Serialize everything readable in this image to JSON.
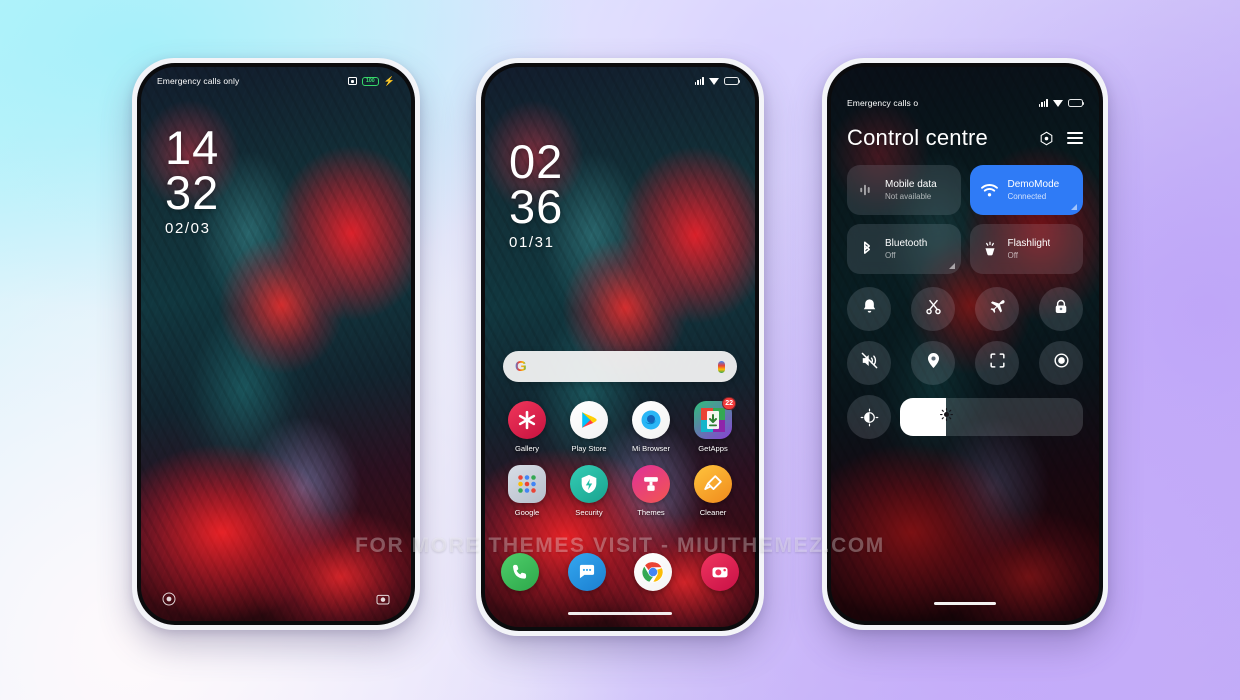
{
  "background": {
    "gradient_from": "#bdf4fb",
    "gradient_mid": "#eef0fd",
    "gradient_to": "#c3aff5"
  },
  "watermark": {
    "text": "FOR MORE THEMES VISIT - MIUITHEMEZ.COM"
  },
  "phone_lockscreen": {
    "status_bar": {
      "carrier": "Emergency calls only",
      "camera_icon": "camera-icon",
      "battery_level": "100",
      "charging_icon": "lightning-bolt-icon"
    },
    "clock": {
      "hours": "14",
      "minutes": "32",
      "date": "02/03"
    },
    "shortcuts": {
      "left": "flashlight-icon",
      "right": "camera-icon"
    }
  },
  "phone_homescreen": {
    "status_bar": {
      "signal_icon": "signal-bars-icon",
      "wifi_icon": "wifi-icon",
      "battery_icon": "battery-icon"
    },
    "clock": {
      "hours": "02",
      "minutes": "36",
      "date": "01/31"
    },
    "search": {
      "google_icon": "google-g-icon",
      "mic_icon": "microphone-icon",
      "placeholder": ""
    },
    "apps_row1": [
      {
        "label": "Gallery",
        "icon": "gallery-icon",
        "color1": "#f0365b",
        "color2": "#c7123f",
        "glyph": "✳",
        "badge": ""
      },
      {
        "label": "Play Store",
        "icon": "play-store-icon",
        "color1": "#ffffff",
        "color2": "#f2f2f2",
        "glyph": "▶",
        "badge": ""
      },
      {
        "label": "Mi Browser",
        "icon": "mi-browser-icon",
        "color1": "#ffffff",
        "color2": "#f2f2f2",
        "glyph": "◕",
        "badge": ""
      },
      {
        "label": "GetApps",
        "icon": "getapps-icon",
        "color1": "#2fc07a",
        "color2": "#8a3fd6",
        "glyph": "⬇",
        "badge": "22"
      }
    ],
    "apps_row2": [
      {
        "label": "Google",
        "icon": "google-folder-icon",
        "color1": "#d8dde6",
        "color2": "#b7bfcb",
        "glyph": "⁙",
        "badge": ""
      },
      {
        "label": "Security",
        "icon": "security-icon",
        "color1": "#34cdb5",
        "color2": "#19a38f",
        "glyph": "⚡",
        "badge": ""
      },
      {
        "label": "Themes",
        "icon": "themes-icon",
        "color1": "#e0309a",
        "color2": "#f2564f",
        "glyph": "✇",
        "badge": ""
      },
      {
        "label": "Cleaner",
        "icon": "cleaner-icon",
        "color1": "#ffc43d",
        "color2": "#f08a1c",
        "glyph": "✒",
        "badge": ""
      }
    ],
    "dock": [
      {
        "label": "Phone",
        "icon": "phone-icon",
        "color1": "#4fce6a",
        "color2": "#2da84b",
        "glyph": "☎"
      },
      {
        "label": "Messages",
        "icon": "messages-icon",
        "color1": "#34a7f0",
        "color2": "#1b7fd0",
        "glyph": "…"
      },
      {
        "label": "Chrome",
        "icon": "chrome-icon",
        "color1": "#ffffff",
        "color2": "#f3f3f3",
        "glyph": "●"
      },
      {
        "label": "Camera",
        "icon": "camera-icon",
        "color1": "#f0355f",
        "color2": "#c81046",
        "glyph": "◉"
      }
    ]
  },
  "phone_controlcentre": {
    "status_bar": {
      "carrier": "Emergency calls o",
      "signal_icon": "signal-bars-icon",
      "wifi_icon": "wifi-icon",
      "battery_icon": "battery-icon"
    },
    "title": "Control centre",
    "actions": [
      {
        "name": "settings-gear-icon"
      },
      {
        "name": "menu-icon"
      }
    ],
    "big_tiles": [
      {
        "name": "Mobile data",
        "status": "Not available",
        "icon": "mobile-data-icon",
        "active": false
      },
      {
        "name": "DemoMode",
        "status": "Connected",
        "icon": "wifi-icon",
        "active": true
      }
    ],
    "wide_tiles": [
      {
        "name": "Bluetooth",
        "status": "Off",
        "icon": "bluetooth-icon",
        "active": false
      },
      {
        "name": "Flashlight",
        "status": "Off",
        "icon": "flashlight-icon",
        "active": false
      }
    ],
    "circle_tiles_row1": [
      {
        "icon": "silent-bell-icon"
      },
      {
        "icon": "scissors-screenshot-icon"
      },
      {
        "icon": "airplane-mode-icon"
      },
      {
        "icon": "lock-icon"
      }
    ],
    "circle_tiles_row2": [
      {
        "icon": "sound-off-icon"
      },
      {
        "icon": "location-icon"
      },
      {
        "icon": "scan-icon"
      },
      {
        "icon": "screen-record-icon"
      }
    ],
    "brightness": {
      "icon": "auto-brightness-icon",
      "slider_icon": "sun-icon",
      "value_percent": 25
    },
    "accent_color": "#2f7bf6"
  }
}
